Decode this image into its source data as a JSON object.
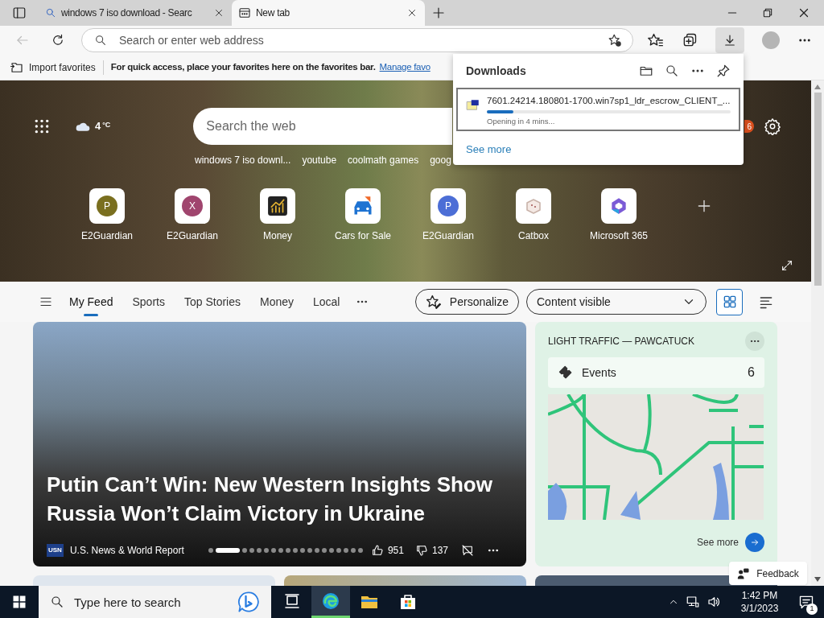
{
  "browser_tabs": [
    {
      "title": "windows 7 iso download - Searc",
      "kind": "search",
      "selected": false
    },
    {
      "title": "New tab",
      "kind": "newtab",
      "selected": true
    }
  ],
  "address_bar": {
    "placeholder": "Search or enter web address"
  },
  "favorites_bar": {
    "import": "Import favorites",
    "hint": "For quick access, place your favorites here on the favorites bar.",
    "link": "Manage favo"
  },
  "downloads_panel": {
    "title": "Downloads",
    "items": [
      {
        "filename": "7601.24214.180801-1700.win7sp1_ldr_escrow_CLIENT_...",
        "level": 0.11,
        "status": "Opening in 4 mins..."
      }
    ],
    "see_more": "See more"
  },
  "hero": {
    "weather": {
      "temp": "4",
      "unit": "°C"
    },
    "search_placeholder": "Search the web",
    "suggestions": [
      "windows 7 iso downl...",
      "youtube",
      "coolmath games",
      "goog"
    ],
    "notification_count": "6",
    "tiles": [
      {
        "kind": "letter",
        "letter": "P",
        "color": "#7a6f1f",
        "label": "E2Guardian"
      },
      {
        "kind": "letter",
        "letter": "X",
        "color": "#a0456e",
        "label": "E2Guardian"
      },
      {
        "kind": "money",
        "label": "Money"
      },
      {
        "kind": "car",
        "label": "Cars for Sale"
      },
      {
        "kind": "letter",
        "letter": "P",
        "color": "#4c6ed6",
        "label": "E2Guardian"
      },
      {
        "kind": "box",
        "label": "Catbox"
      },
      {
        "kind": "ring",
        "label": "Microsoft 365"
      }
    ]
  },
  "feed_nav": {
    "tabs": [
      {
        "label": "My Feed",
        "selected": true
      },
      {
        "label": "Sports",
        "selected": false
      },
      {
        "label": "Top Stories",
        "selected": false
      },
      {
        "label": "Money",
        "selected": false
      },
      {
        "label": "Local",
        "selected": false
      }
    ],
    "personalize": "Personalize",
    "content_filter": "Content visible",
    "views": [
      {
        "kind": "grid",
        "selected": true
      },
      {
        "kind": "list",
        "selected": false
      }
    ]
  },
  "headline_card": {
    "title": "Putin Can’t Win: New Western Insights Show Russia Won’t Claim Victory in Ukraine",
    "source_logo": "USN",
    "source": "U.S. News & World Report",
    "likes": "951",
    "dislikes": "137",
    "pager": [
      {
        "selected": false
      },
      {
        "selected": true
      },
      {
        "selected": false
      },
      {
        "selected": false
      },
      {
        "selected": false
      },
      {
        "selected": false
      },
      {
        "selected": false
      },
      {
        "selected": false
      },
      {
        "selected": false
      },
      {
        "selected": false
      },
      {
        "selected": false
      },
      {
        "selected": false
      },
      {
        "selected": false
      },
      {
        "selected": false
      },
      {
        "selected": false
      },
      {
        "selected": false
      },
      {
        "selected": false
      },
      {
        "selected": false
      },
      {
        "selected": false
      }
    ]
  },
  "traffic_card": {
    "title": "LIGHT TRAFFIC — PAWCATUCK",
    "events_label": "Events",
    "events_count": "6",
    "see_more": "See more"
  },
  "feedback": "Feedback",
  "taskbar": {
    "search_placeholder": "Type here to search",
    "apps": [
      {
        "kind": "taskview",
        "active": false
      },
      {
        "kind": "edge",
        "active": true
      },
      {
        "kind": "explorer",
        "active": false
      },
      {
        "kind": "store",
        "active": false
      }
    ],
    "time": "1:42 PM",
    "date": "3/1/2023",
    "notification_count": "1"
  }
}
